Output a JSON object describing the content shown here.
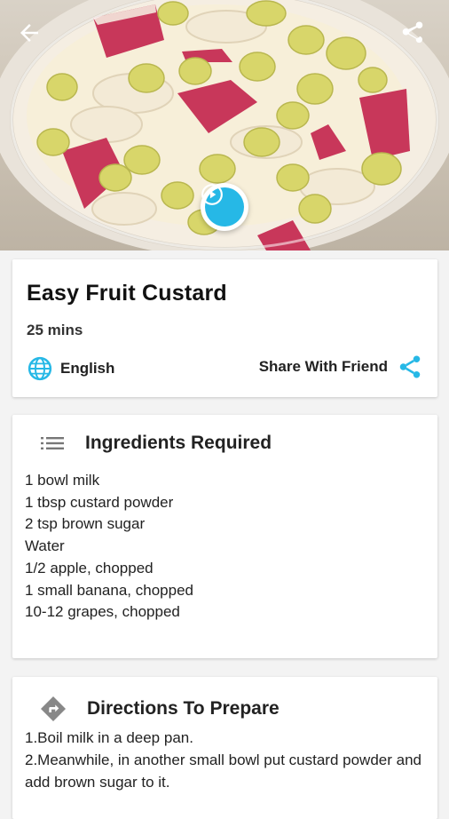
{
  "recipe": {
    "title": "Easy Fruit Custard",
    "time": "25 mins",
    "language": "English",
    "share_label": "Share With Friend"
  },
  "ingredients": {
    "heading": "Ingredients Required",
    "items": [
      "1 bowl milk",
      "1 tbsp custard powder",
      "2 tsp brown sugar",
      "Water",
      "1/2 apple, chopped",
      "1 small banana, chopped",
      "10-12 grapes, chopped"
    ]
  },
  "directions": {
    "heading": "Directions To Prepare",
    "steps": [
      "1.Boil milk in a deep pan.",
      "2.Meanwhile, in another small bowl put custard powder and add brown sugar to it."
    ]
  },
  "icons": {
    "back": "arrow-left-icon",
    "share": "share-icon",
    "play": "play-icon",
    "language": "globe-icon",
    "ingredients": "list-icon",
    "directions": "directions-icon"
  },
  "colors": {
    "accent": "#26b8e6",
    "text": "#222222",
    "background": "#f3f3f3"
  }
}
